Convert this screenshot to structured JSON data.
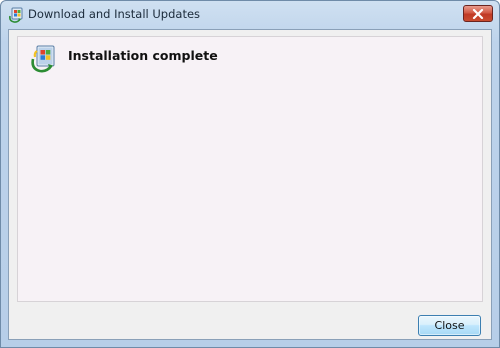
{
  "window": {
    "title": "Download and Install Updates",
    "title_icon": "windows-update-icon",
    "close_icon": "close-icon"
  },
  "content": {
    "icon": "windows-update-icon",
    "heading": "Installation complete"
  },
  "footer": {
    "close_label": "Close"
  },
  "colors": {
    "titlebar": "#bdd3eb",
    "close_x": "#c94c30",
    "panel_bg": "#f7f2f6",
    "button_border": "#3c7fb1"
  }
}
